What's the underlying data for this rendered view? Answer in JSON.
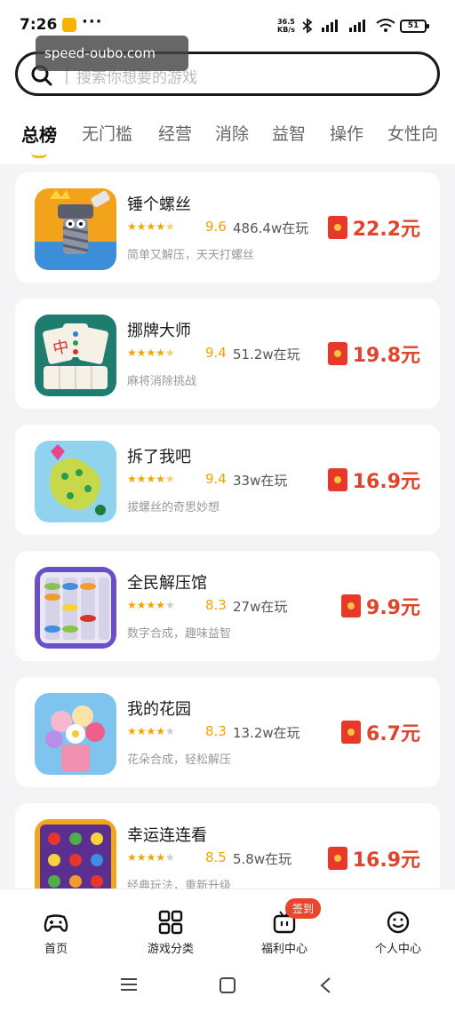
{
  "status": {
    "time": "7:26",
    "more": "···",
    "speed_value": "36.5",
    "speed_unit": "KB/s",
    "battery": "51"
  },
  "watermark": "speed-oubo.com",
  "search": {
    "placeholder": "搜索你想要的游戏"
  },
  "tabs": [
    {
      "label": "总榜",
      "active": true
    },
    {
      "label": "无门槛"
    },
    {
      "label": "经营"
    },
    {
      "label": "消除"
    },
    {
      "label": "益智"
    },
    {
      "label": "操作"
    },
    {
      "label": "女性向"
    }
  ],
  "games": [
    {
      "name": "锤个螺丝",
      "stars": 4.5,
      "score": "9.6",
      "players": "486.4w在玩",
      "desc": "简单又解压，天天打螺丝",
      "reward": "22.2元"
    },
    {
      "name": "挪牌大师",
      "stars": 4.5,
      "score": "9.4",
      "players": "51.2w在玩",
      "desc": "麻将消除挑战",
      "reward": "19.8元"
    },
    {
      "name": "拆了我吧",
      "stars": 4.5,
      "score": "9.4",
      "players": "33w在玩",
      "desc": "拔螺丝的奇思妙想",
      "reward": "16.9元"
    },
    {
      "name": "全民解压馆",
      "stars": 4,
      "score": "8.3",
      "players": "27w在玩",
      "desc": "数字合成，趣味益智",
      "reward": "9.9元"
    },
    {
      "name": "我的花园",
      "stars": 4,
      "score": "8.3",
      "players": "13.2w在玩",
      "desc": "花朵合成，轻松解压",
      "reward": "6.7元"
    },
    {
      "name": "幸运连连看",
      "stars": 4,
      "score": "8.5",
      "players": "5.8w在玩",
      "desc": "经典玩法，重新升级",
      "reward": "16.9元"
    }
  ],
  "bottom_nav": [
    {
      "label": "首页",
      "icon": "gamepad-icon"
    },
    {
      "label": "游戏分类",
      "icon": "grid-icon"
    },
    {
      "label": "福利中心",
      "icon": "tv-gift-icon",
      "badge": "签到"
    },
    {
      "label": "个人中心",
      "icon": "smiley-icon"
    }
  ],
  "colors": {
    "accent_yellow": "#f2c200",
    "star": "#f2a400",
    "reward_red": "#e0452b"
  }
}
